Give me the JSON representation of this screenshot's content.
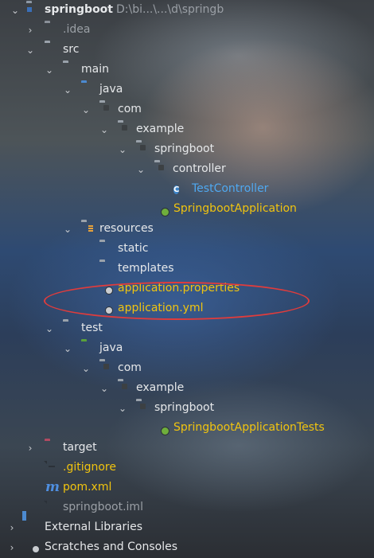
{
  "project_tree": {
    "root": {
      "label": "springboot",
      "path": "D:\\bi...\\...\\d\\springb"
    },
    "items": [
      {
        "label": ".idea"
      },
      {
        "label": "src"
      },
      {
        "label": "main"
      },
      {
        "label": "java"
      },
      {
        "label": "com"
      },
      {
        "label": "example"
      },
      {
        "label": "springboot"
      },
      {
        "label": "controller"
      },
      {
        "label": "TestController"
      },
      {
        "label": "SpringbootApplication"
      },
      {
        "label": "resources"
      },
      {
        "label": "static"
      },
      {
        "label": "templates"
      },
      {
        "label": "application.properties"
      },
      {
        "label": "application.yml"
      },
      {
        "label": "test"
      },
      {
        "label": "java"
      },
      {
        "label": "com"
      },
      {
        "label": "example"
      },
      {
        "label": "springboot"
      },
      {
        "label": "SpringbootApplicationTests"
      },
      {
        "label": "target"
      },
      {
        "label": ".gitignore"
      },
      {
        "label": "pom.xml"
      },
      {
        "label": "springboot.iml"
      },
      {
        "label": "External Libraries"
      },
      {
        "label": "Scratches and Consoles"
      }
    ]
  },
  "annotation": {
    "color": "#e03c3c"
  },
  "colors": {
    "class_text": "#4fa8f0",
    "highlight_text": "#f1c40f",
    "default_text": "#e6e8ea"
  }
}
